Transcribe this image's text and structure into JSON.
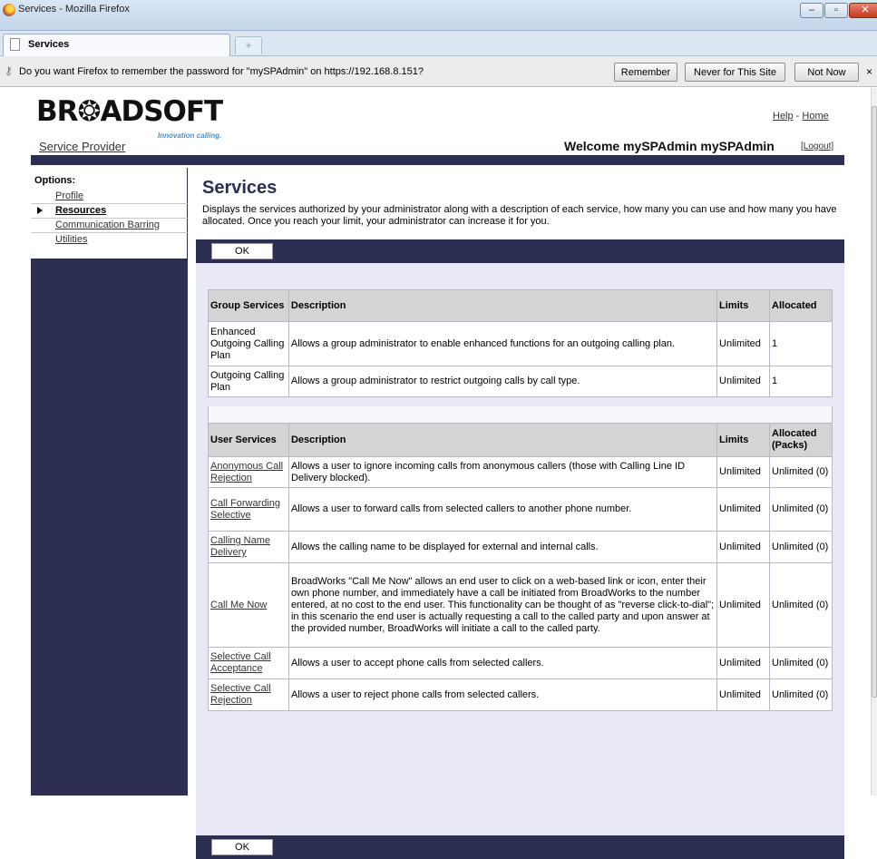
{
  "window": {
    "title": "Services - Mozilla Firefox",
    "min_glyph": "–",
    "max_glyph": "▫",
    "close_glyph": "✕"
  },
  "tabs": [
    {
      "label": "Services"
    }
  ],
  "new_tab_glyph": "+",
  "password_bar": {
    "message": "Do you want Firefox to remember the password for \"mySPAdmin\" on https://192.168.8.151?",
    "remember": "Remember",
    "never": "Never for This Site",
    "not_now": "Not Now",
    "close_glyph": "×"
  },
  "header": {
    "logo_text": "BR❂ADSOFT",
    "tagline": "Innovation calling.",
    "help": "Help",
    "separator": " - ",
    "home": "Home",
    "service_provider": "Service Provider",
    "welcome": "Welcome mySPAdmin mySPAdmin",
    "logout": "[Logout]"
  },
  "nav": {
    "title": "Options:",
    "items": [
      {
        "label": "Profile"
      },
      {
        "label": "Resources"
      },
      {
        "label": "Communication Barring"
      },
      {
        "label": "Utilities"
      }
    ]
  },
  "main": {
    "title": "Services",
    "description": "Displays the services authorized by your administrator along with a description of each service, how many you can use and how many you have allocated. Once you reach your limit, your administrator can increase it for you.",
    "ok_label": "OK"
  },
  "group_table": {
    "headers": [
      "Group Services",
      "Description",
      "Limits",
      "Allocated"
    ],
    "rows": [
      {
        "service": "Enhanced Outgoing Calling Plan",
        "description": "Allows a group administrator to enable enhanced functions for an outgoing calling plan.",
        "limit": "Unlimited",
        "allocated": "1"
      },
      {
        "service": "Outgoing Calling Plan",
        "description": "Allows a group administrator to restrict outgoing calls by call type.",
        "limit": "Unlimited",
        "allocated": "1"
      }
    ]
  },
  "user_table": {
    "headers": [
      "User Services",
      "Description",
      "Limits",
      "Allocated (Packs)"
    ],
    "rows": [
      {
        "service": "Anonymous Call Rejection",
        "description": "Allows a user to ignore incoming calls from anonymous callers (those with Calling Line ID Delivery blocked).",
        "limit": "Unlimited",
        "allocated": "Unlimited (0)"
      },
      {
        "service": "Call Forwarding Selective",
        "description": "Allows a user to forward calls from selected callers to another phone number.",
        "limit": "Unlimited",
        "allocated": "Unlimited (0)"
      },
      {
        "service": "Calling Name Delivery",
        "description": "Allows the calling name to be displayed for external and internal calls.",
        "limit": "Unlimited",
        "allocated": "Unlimited (0)"
      },
      {
        "service": "Call Me Now",
        "description": "BroadWorks \"Call Me Now\" allows an end user to click on a web-based link or icon, enter their own phone number, and immediately have a call be initiated from BroadWorks to the number entered, at no cost to the end user. This functionality can be thought of as \"reverse click-to-dial\"; in this scenario the end user is actually requesting a call to the called party and upon answer at the provided number, BroadWorks will initiate a call to the called party.",
        "limit": "Unlimited",
        "allocated": "Unlimited (0)"
      },
      {
        "service": "Selective Call Acceptance",
        "description": "Allows a user to accept phone calls from selected callers.",
        "limit": "Unlimited",
        "allocated": "Unlimited (0)"
      },
      {
        "service": "Selective Call Rejection",
        "description": "Allows a user to reject phone calls from selected callers.",
        "limit": "Unlimited",
        "allocated": "Unlimited (0)"
      }
    ]
  }
}
